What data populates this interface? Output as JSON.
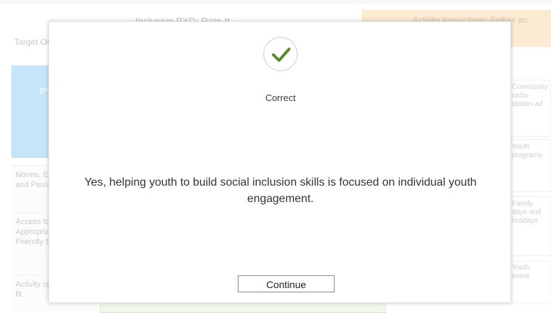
{
  "background": {
    "header_title": "Inclusive PYD: Rate It",
    "left_target": "Target Outcomes",
    "left_blue_box": "PYD Tools",
    "left_items": [
      "Norms, Expectations and Perceptions",
      "Access to Age-Appropriate, Youth Friendly Services",
      "Activity options do not fit"
    ],
    "right_header": "Activity Instructions: Follow an Analytic",
    "right_cards": [
      "Community radio-station ad",
      "Youth programs",
      "Family days and holidays",
      "Youth event"
    ]
  },
  "modal": {
    "status_icon": "checkmark-icon",
    "status_color": "#5a8a2a",
    "status_label": "Correct",
    "feedback": "Yes, helping youth to build social inclusion skills is focused on individual youth engagement.",
    "continue_label": "Continue"
  }
}
